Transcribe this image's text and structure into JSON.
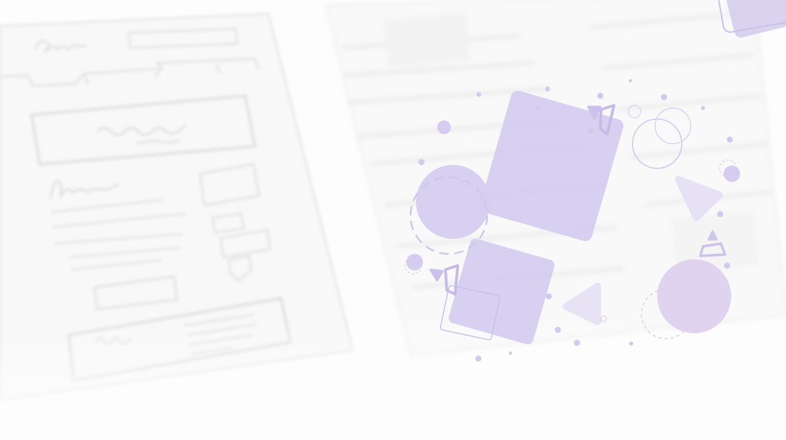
{
  "colors": {
    "background": "#fdfdfd",
    "sketch_line": "#d7d7d7",
    "sketch_paper": "#f6f6f6",
    "accent_fill": "#d9d3ef",
    "accent_fill_strong": "#cdc4ea",
    "accent_stroke": "#c6bce6",
    "accent_pink": "#e2d5ee"
  },
  "scene": {
    "description_kind": "decorative-illustration",
    "left_element": "sketch-wireframe",
    "right_element": "abstract-purple-shapes"
  }
}
